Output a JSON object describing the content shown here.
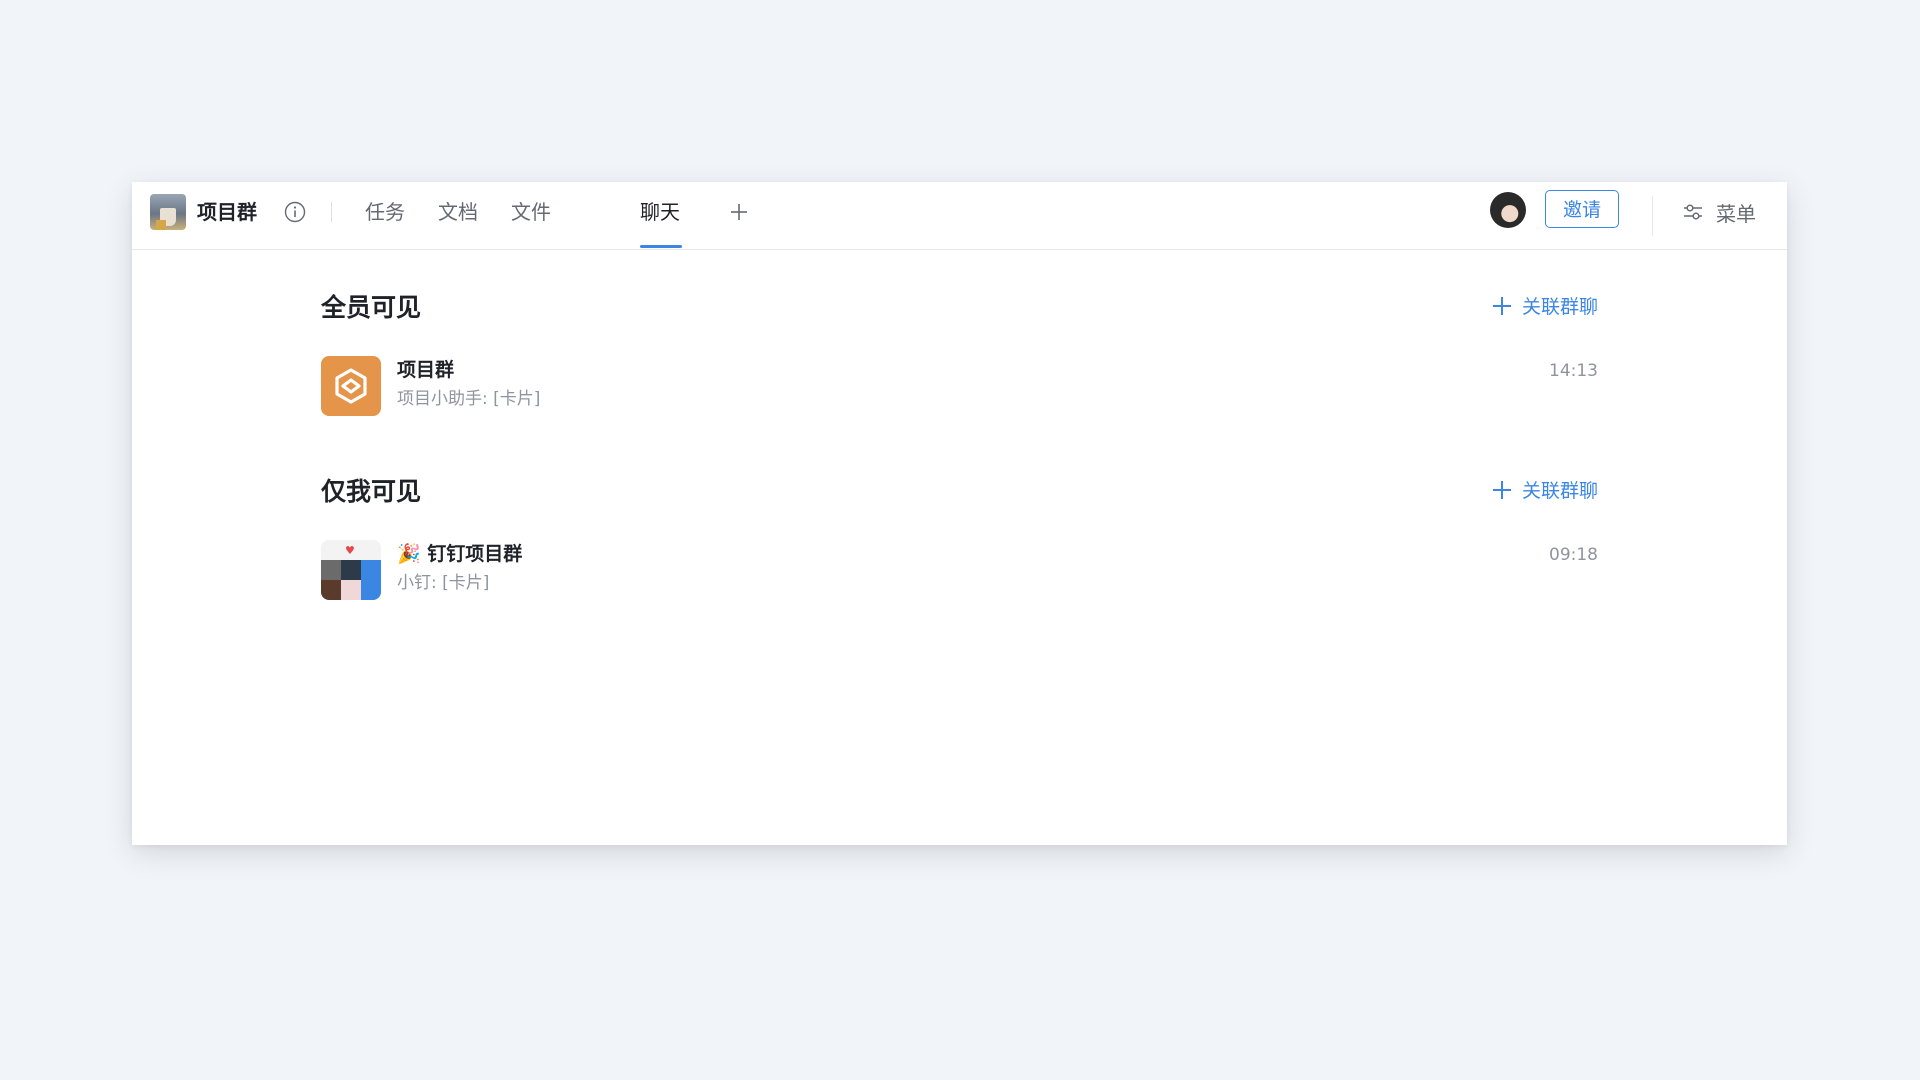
{
  "header": {
    "title": "项目群",
    "tabs": [
      {
        "label": "任务",
        "active": false
      },
      {
        "label": "文档",
        "active": false
      },
      {
        "label": "文件",
        "active": false
      },
      {
        "label": "聊天",
        "active": true
      }
    ],
    "invite_label": "邀请",
    "menu_label": "菜单"
  },
  "sections": [
    {
      "title": "全员可见",
      "link_label": "关联群聊",
      "chats": [
        {
          "name": "项目群",
          "preview": "项目小助手: [卡片]",
          "time": "14:13",
          "icon": "project-hexagon-icon",
          "icon_color": "#e5954a"
        }
      ]
    },
    {
      "title": "仅我可见",
      "link_label": "关联群聊",
      "chats": [
        {
          "name": "🎉 钉钉项目群",
          "preview": "小钉: [卡片]",
          "time": "09:18",
          "icon": "group-collage-avatar"
        }
      ]
    }
  ],
  "colors": {
    "accent": "#3b86e3",
    "background": "#f1f5f9",
    "project_icon": "#e5954a"
  }
}
